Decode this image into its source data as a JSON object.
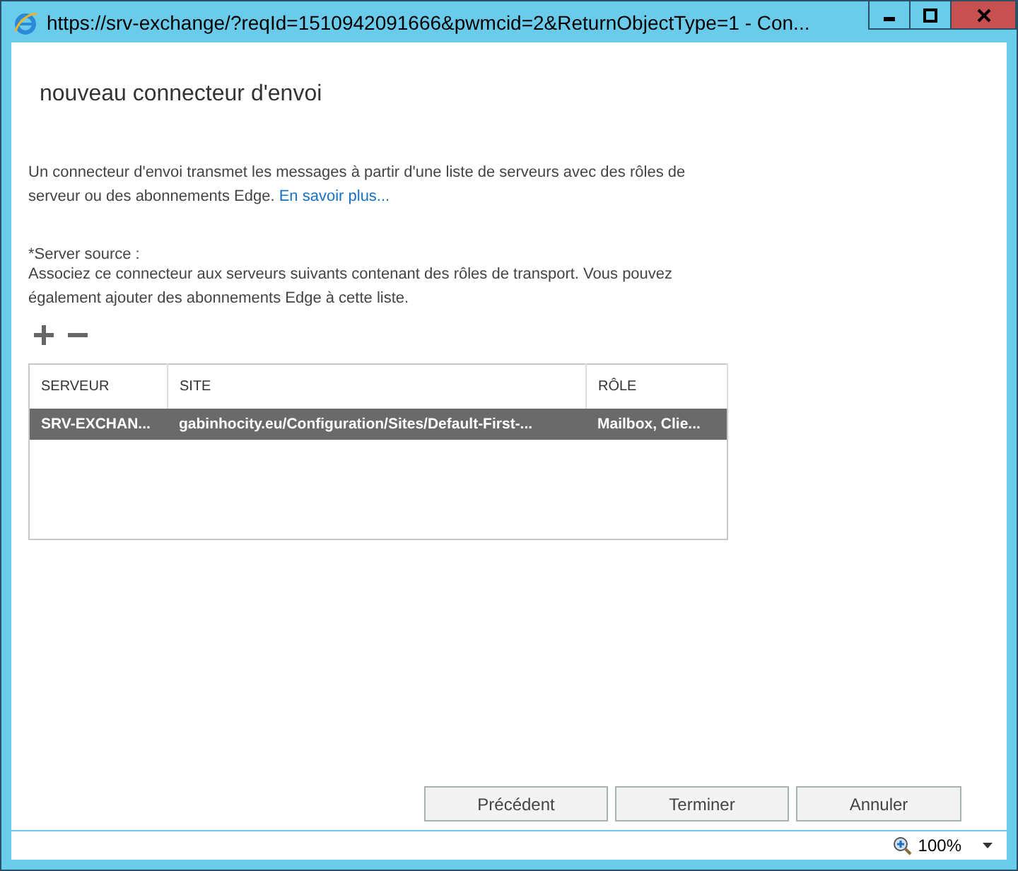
{
  "window": {
    "title": "https://srv-exchange/?reqId=1510942091666&pwmcid=2&ReturnObjectType=1 - Con..."
  },
  "page_title": "nouveau connecteur d'envoi",
  "intro": {
    "text": "Un connecteur d'envoi transmet les messages à partir d'une liste de serveurs avec des rôles de serveur ou des abonnements Edge.",
    "link": "En savoir plus..."
  },
  "source": {
    "label": "*Server source :",
    "description": "Associez ce connecteur aux serveurs suivants contenant des rôles de transport. Vous pouvez également ajouter des abonnements Edge à cette liste."
  },
  "table": {
    "columns": [
      "SERVEUR",
      "SITE",
      "RÔLE"
    ],
    "rows": [
      {
        "cells": [
          "SRV-EXCHAN...",
          "gabinhocity.eu/Configuration/Sites/Default-First-...",
          "Mailbox, Clie..."
        ],
        "selected": true
      }
    ]
  },
  "buttons": [
    "Précédent",
    "Terminer",
    "Annuler"
  ],
  "status_bar": {
    "zoom": "100%"
  }
}
